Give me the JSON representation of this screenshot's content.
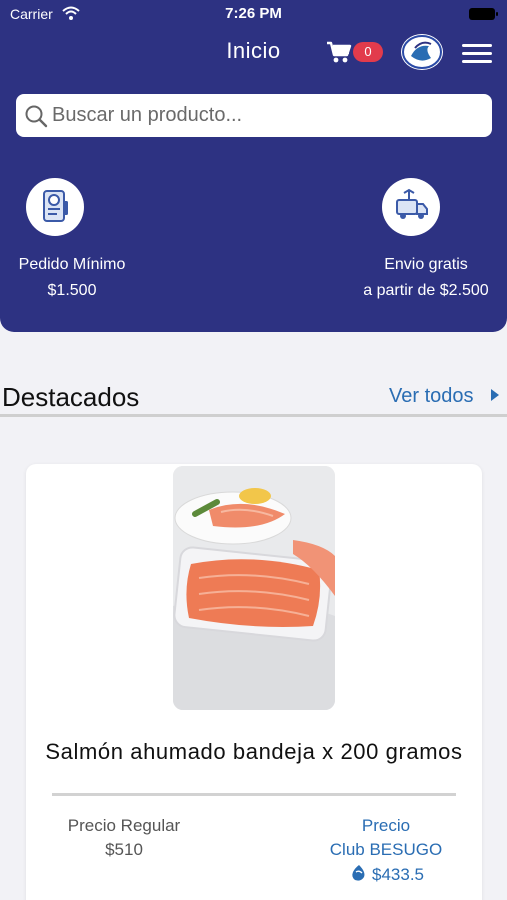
{
  "status_bar": {
    "carrier": "Carrier",
    "time": "7:26 PM"
  },
  "nav": {
    "title": "Inicio",
    "cart_count": "0"
  },
  "search": {
    "placeholder": "Buscar un producto..."
  },
  "info": [
    {
      "label": "Pedido Mínimo",
      "value": "$1.500",
      "icon": "receipt-icon"
    },
    {
      "label": "Envio gratis",
      "value": "a partir de $2.500",
      "icon": "delivery-truck-icon"
    }
  ],
  "featured": {
    "title": "Destacados",
    "see_all": "Ver todos",
    "product": {
      "name": "Salmón ahumado bandeja x 200 gramos",
      "regular_label": "Precio Regular",
      "regular_price": "$510",
      "club_label_1": "Precio",
      "club_label_2": "Club BESUGO",
      "club_price": "$433.5"
    }
  },
  "colors": {
    "header": "#2d3282",
    "badge": "#e23b4c",
    "accent": "#2a6db3"
  }
}
